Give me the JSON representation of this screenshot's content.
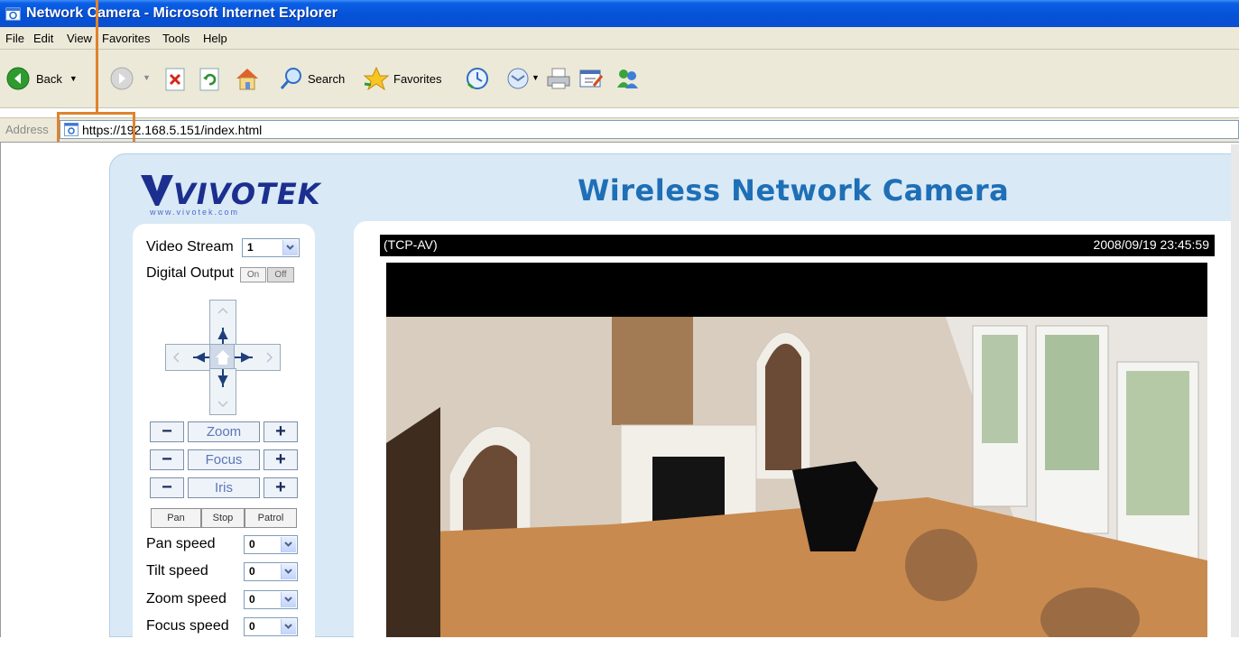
{
  "window": {
    "title": "Network Camera - Microsoft Internet Explorer"
  },
  "menu": {
    "items": [
      "File",
      "Edit",
      "View",
      "Favorites",
      "Tools",
      "Help"
    ]
  },
  "toolbar": {
    "back_label": "Back",
    "search_label": "Search",
    "favorites_label": "Favorites"
  },
  "address": {
    "label": "Address",
    "url": "https://192.168.5.151/index.html"
  },
  "brand": {
    "logo_text": "VIVOTEK",
    "logo_sub": "www.vivotek.com"
  },
  "page": {
    "title": "Wireless Network Camera"
  },
  "controls": {
    "video_stream_label": "Video Stream",
    "video_stream_value": "1",
    "digital_output_label": "Digital Output",
    "do_on": "On",
    "do_off": "Off",
    "zoom_label": "Zoom",
    "focus_label": "Focus",
    "iris_label": "Iris",
    "minus": "−",
    "plus": "+",
    "pan_btn": "Pan",
    "stop_btn": "Stop",
    "patrol_btn": "Patrol",
    "pan_speed_label": "Pan speed",
    "pan_speed_value": "0",
    "tilt_speed_label": "Tilt speed",
    "tilt_speed_value": "0",
    "zoom_speed_label": "Zoom speed",
    "zoom_speed_value": "0",
    "focus_speed_label": "Focus speed",
    "focus_speed_value": "0"
  },
  "video": {
    "protocol": "(TCP-AV)",
    "timestamp": "2008/09/19 23:45:59"
  },
  "colors": {
    "title_blue": "#1e6fb6",
    "panel_blue": "#d9e9f6",
    "callout_orange": "#e0832d",
    "xp_title": "#0652d6"
  }
}
